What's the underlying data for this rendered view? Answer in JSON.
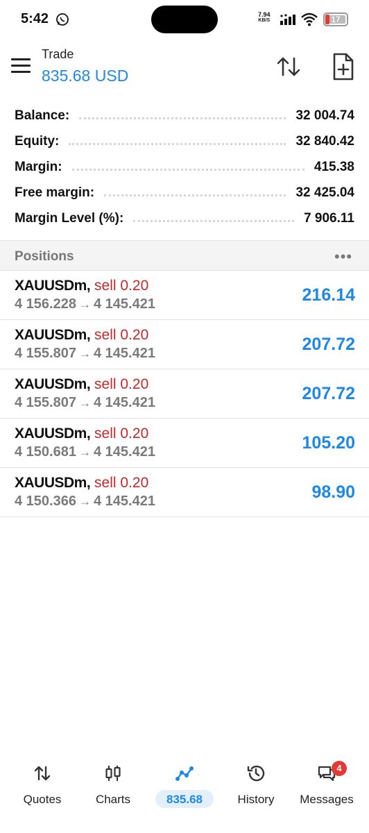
{
  "status_bar": {
    "time": "5:42",
    "net_speed_value": "7.94",
    "net_speed_unit": "KB/S",
    "battery": "17"
  },
  "header": {
    "title": "Trade",
    "amount": "835.68 USD"
  },
  "summary": [
    {
      "label": "Balance:",
      "value": "32 004.74"
    },
    {
      "label": "Equity:",
      "value": "32 840.42"
    },
    {
      "label": "Margin:",
      "value": "415.38"
    },
    {
      "label": "Free margin:",
      "value": "32 425.04"
    },
    {
      "label": "Margin Level (%):",
      "value": "7 906.11"
    }
  ],
  "positions": {
    "title": "Positions",
    "more": "•••",
    "items": [
      {
        "symbol": "XAUUSDm,",
        "side": "sell 0.20",
        "open": "4 156.228",
        "current": "4 145.421",
        "profit": "216.14"
      },
      {
        "symbol": "XAUUSDm,",
        "side": "sell 0.20",
        "open": "4 155.807",
        "current": "4 145.421",
        "profit": "207.72"
      },
      {
        "symbol": "XAUUSDm,",
        "side": "sell 0.20",
        "open": "4 155.807",
        "current": "4 145.421",
        "profit": "207.72"
      },
      {
        "symbol": "XAUUSDm,",
        "side": "sell 0.20",
        "open": "4 150.681",
        "current": "4 145.421",
        "profit": "105.20"
      },
      {
        "symbol": "XAUUSDm,",
        "side": "sell 0.20",
        "open": "4 150.366",
        "current": "4 145.421",
        "profit": "98.90"
      }
    ],
    "arrow": "→"
  },
  "bottom_nav": {
    "items": [
      {
        "label": "Quotes",
        "icon": "quotes-arrows-icon"
      },
      {
        "label": "Charts",
        "icon": "candlestick-icon"
      },
      {
        "label": "835.68",
        "icon": "trade-line-icon",
        "active": true
      },
      {
        "label": "History",
        "icon": "history-clock-icon"
      },
      {
        "label": "Messages",
        "icon": "messages-icon",
        "badge": "4"
      }
    ]
  },
  "colors": {
    "accent_blue": "#1e88e5",
    "sell_red": "#c62828",
    "badge_red": "#e53935"
  }
}
